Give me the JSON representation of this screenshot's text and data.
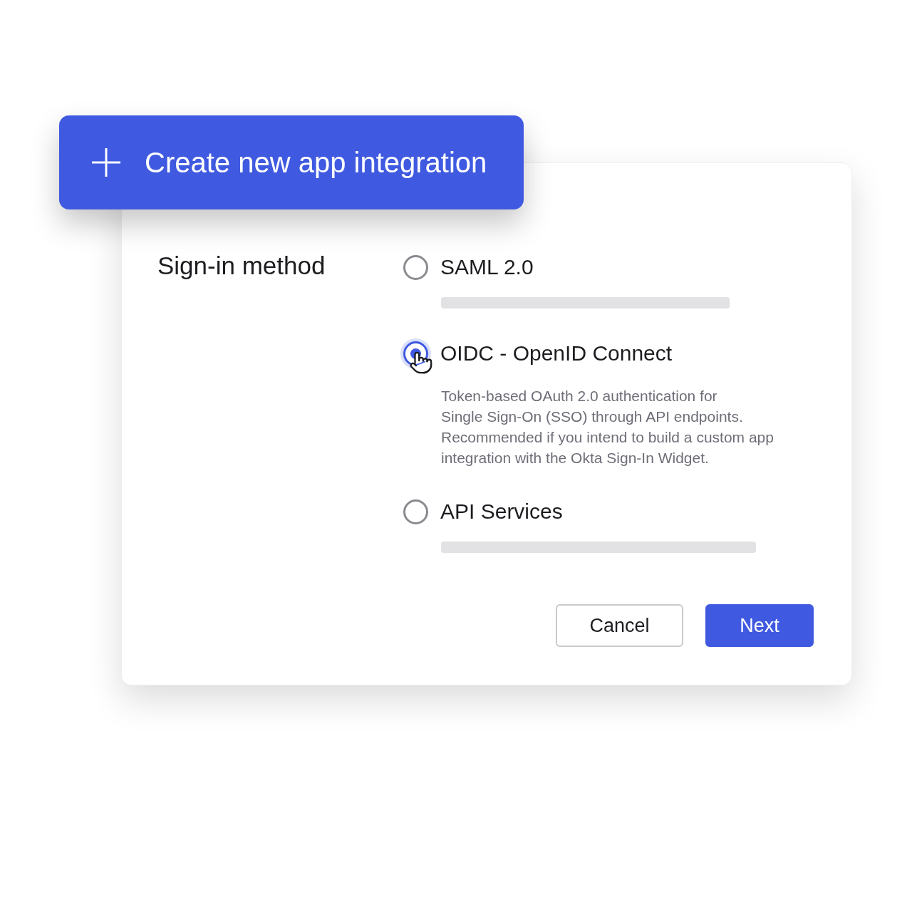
{
  "header_button": {
    "label": "Create new app integration"
  },
  "section_label": "Sign-in method",
  "options": [
    {
      "label": "SAML 2.0",
      "selected": false
    },
    {
      "label": "OIDC - OpenID Connect",
      "selected": true,
      "description_lines": [
        "Token-based OAuth 2.0 authentication for",
        "Single Sign-On (SSO) through API endpoints.",
        "Recommended if you intend to build a custom app",
        "integration with the Okta Sign-In Widget."
      ]
    },
    {
      "label": "API Services",
      "selected": false
    }
  ],
  "buttons": [
    {
      "label": "Cancel",
      "kind": "secondary"
    },
    {
      "label": "Next",
      "kind": "primary"
    }
  ]
}
